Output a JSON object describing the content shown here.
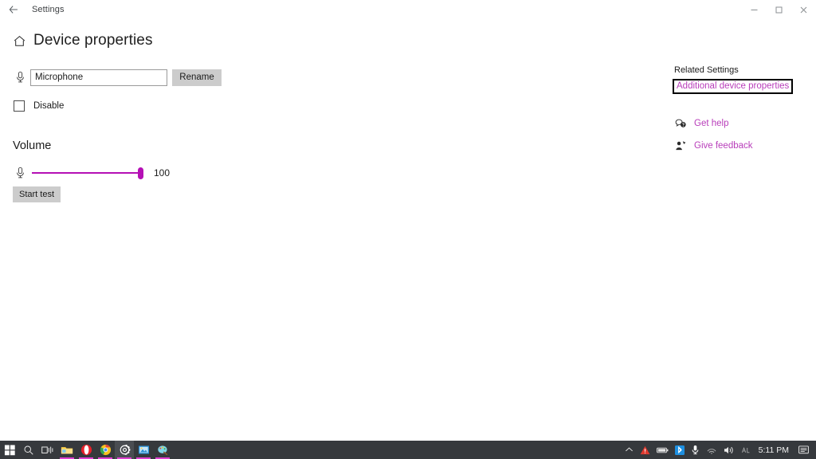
{
  "window": {
    "titlebar": {
      "back_label": "back-arrow",
      "title": "Settings",
      "minimize_label": "Minimize",
      "maximize_label": "Restore",
      "close_label": "Close"
    },
    "page_title": "Device properties",
    "home_icon": "home-icon"
  },
  "device": {
    "mic_icon": "microphone-icon",
    "name_value": "Microphone",
    "name_placeholder": "Microphone",
    "rename_label": "Rename",
    "disable_label": "Disable",
    "disable_checked": false
  },
  "volume": {
    "heading": "Volume",
    "mic_icon": "microphone-icon",
    "value": "100",
    "percent": 100,
    "start_test_label": "Start test",
    "accent_color": "#b510b5"
  },
  "related": {
    "heading": "Related Settings",
    "additional_props_label": "Additional device properties",
    "links": [
      {
        "icon": "get-help-icon",
        "label": "Get help"
      },
      {
        "icon": "give-feedback-icon",
        "label": "Give feedback"
      }
    ],
    "link_color": "#b83dba",
    "focus_border_color": "#000000"
  },
  "taskbar": {
    "background": "#36393d",
    "accent_underline": "#e040d0",
    "items": [
      {
        "name": "start-button",
        "label": "Start",
        "active": false,
        "running": false
      },
      {
        "name": "search-button",
        "label": "Search",
        "active": false,
        "running": false
      },
      {
        "name": "task-view-button",
        "label": "Task View",
        "active": false,
        "running": false
      },
      {
        "name": "file-explorer-button",
        "label": "File Explorer",
        "active": false,
        "running": true
      },
      {
        "name": "opera-button",
        "label": "Opera",
        "active": false,
        "running": true
      },
      {
        "name": "chrome-button",
        "label": "Google Chrome",
        "active": false,
        "running": true
      },
      {
        "name": "settings-button",
        "label": "Settings",
        "active": true,
        "running": true
      },
      {
        "name": "photos-button",
        "label": "Photos",
        "active": false,
        "running": true
      },
      {
        "name": "paint-button",
        "label": "Paint 3D",
        "active": false,
        "running": true
      }
    ],
    "tray": [
      {
        "name": "show-hidden-icons",
        "label": "Show hidden icons"
      },
      {
        "name": "warning-icon",
        "label": "Warning"
      },
      {
        "name": "battery-icon",
        "label": "Battery"
      },
      {
        "name": "bluetooth-icon",
        "label": "Bluetooth"
      },
      {
        "name": "microphone-icon",
        "label": "Microphone in use"
      },
      {
        "name": "network-icon",
        "label": "Network"
      },
      {
        "name": "volume-icon",
        "label": "Volume"
      },
      {
        "name": "language-icon",
        "label": "ENG"
      }
    ],
    "clock": "5:11 PM",
    "action_center_label": "Notifications"
  }
}
